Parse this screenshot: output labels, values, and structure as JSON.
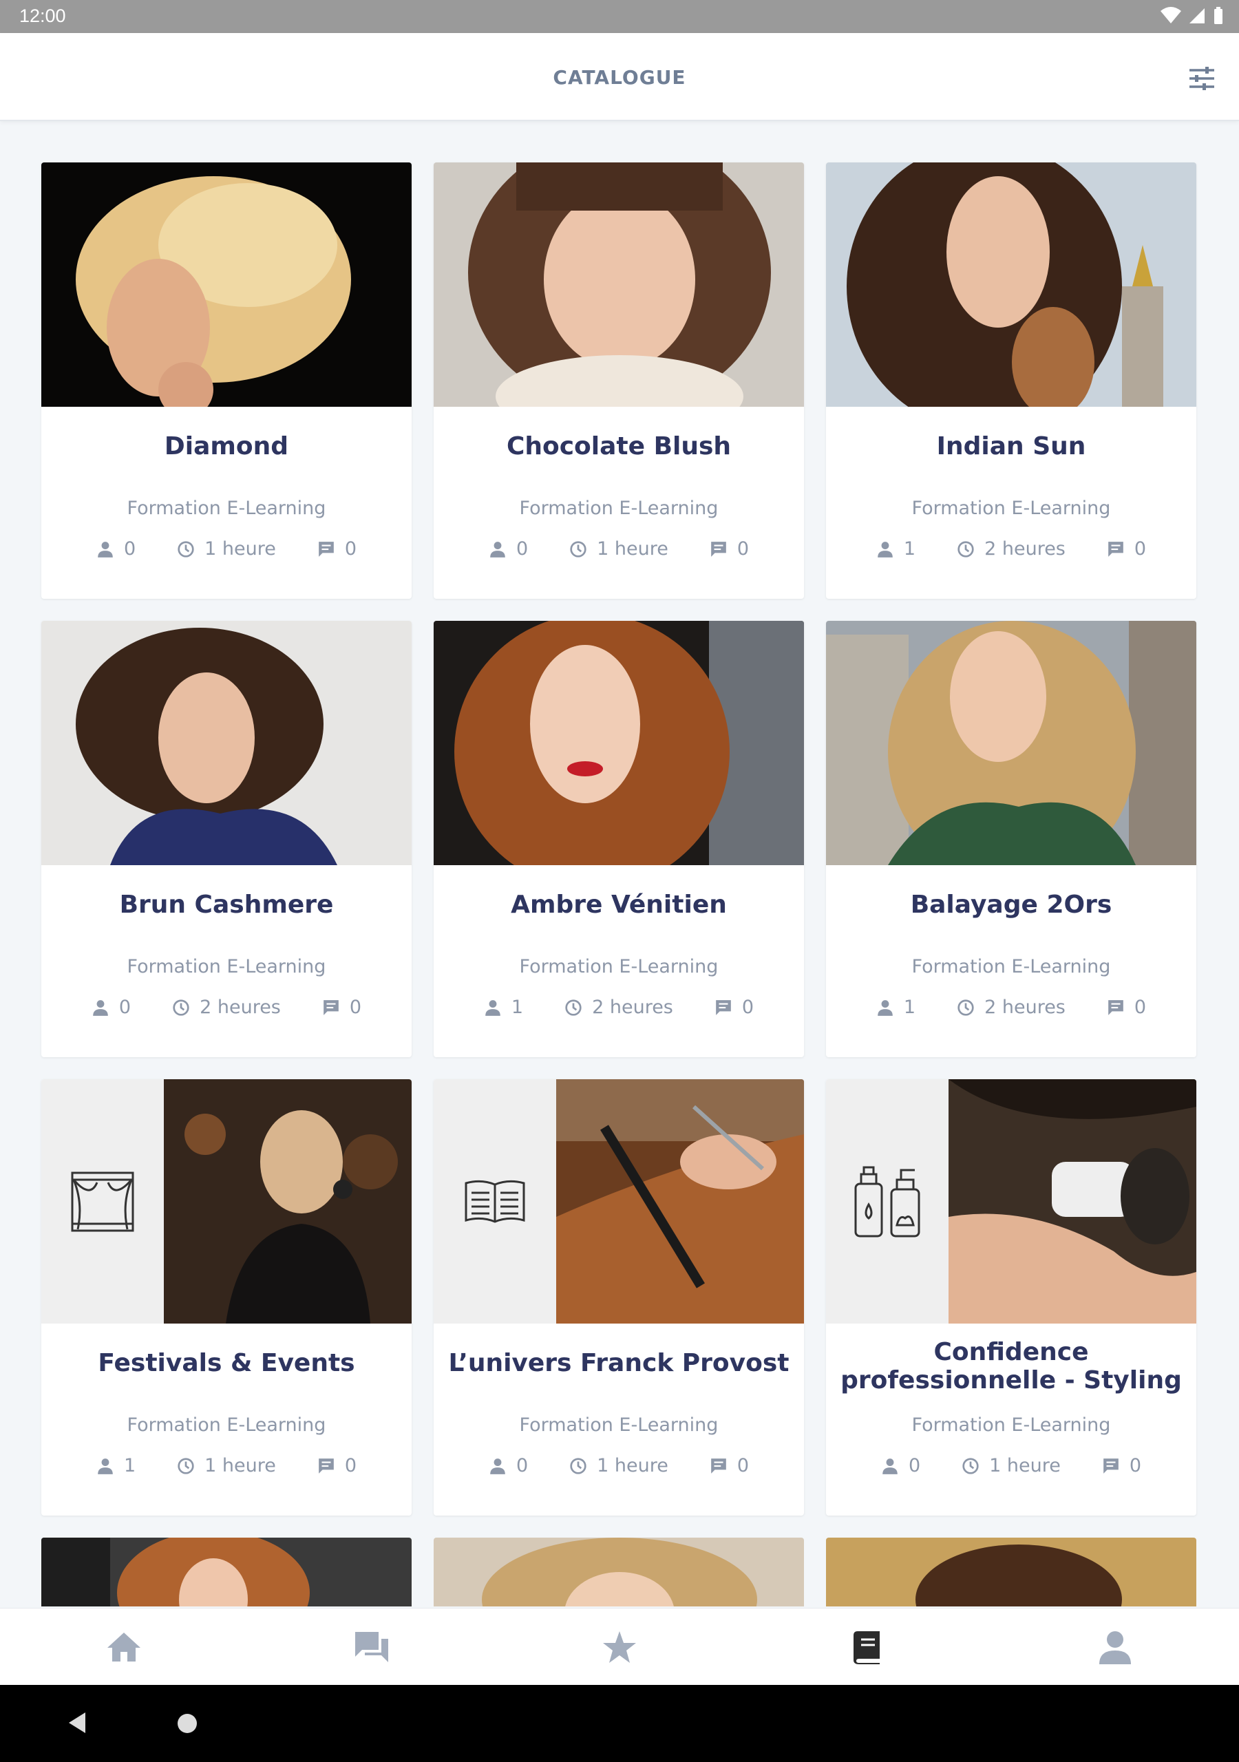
{
  "status_bar": {
    "time": "12:00"
  },
  "app_bar": {
    "title": "CATALOGUE"
  },
  "colors": {
    "title": "#2e3560",
    "muted": "#8d97a8",
    "nav_active": "#2b2b2b",
    "nav_inactive": "#a3adbd"
  },
  "cards": [
    {
      "name": "Diamond",
      "kind": "Formation E-Learning",
      "learners": "0",
      "duration": "1 heure",
      "comments": "0"
    },
    {
      "name": "Chocolate Blush",
      "kind": "Formation E-Learning",
      "learners": "0",
      "duration": "1 heure",
      "comments": "0"
    },
    {
      "name": "Indian Sun",
      "kind": "Formation E-Learning",
      "learners": "1",
      "duration": "2 heures",
      "comments": "0"
    },
    {
      "name": "Brun Cashmere",
      "kind": "Formation E-Learning",
      "learners": "0",
      "duration": "2 heures",
      "comments": "0"
    },
    {
      "name": "Ambre Vénitien",
      "kind": "Formation E-Learning",
      "learners": "1",
      "duration": "2 heures",
      "comments": "0"
    },
    {
      "name": "Balayage 2Ors",
      "kind": "Formation E-Learning",
      "learners": "1",
      "duration": "2 heures",
      "comments": "0"
    },
    {
      "name": "Festivals & Events",
      "kind": "Formation E-Learning",
      "learners": "1",
      "duration": "1 heure",
      "comments": "0",
      "icon": "theater-icon"
    },
    {
      "name": "L’univers Franck Provost",
      "kind": "Formation E-Learning",
      "learners": "0",
      "duration": "1 heure",
      "comments": "0",
      "icon": "book-icon"
    },
    {
      "name": "Confidence professionnelle - Styling",
      "kind": "Formation E-Learning",
      "learners": "0",
      "duration": "1 heure",
      "comments": "0",
      "icon": "bottles-icon"
    }
  ],
  "bottom_nav": [
    {
      "icon": "home-icon",
      "active": false
    },
    {
      "icon": "chat-icon",
      "active": false
    },
    {
      "icon": "star-icon",
      "active": false
    },
    {
      "icon": "catalogue-book-icon",
      "active": true
    },
    {
      "icon": "profile-icon",
      "active": false
    }
  ]
}
